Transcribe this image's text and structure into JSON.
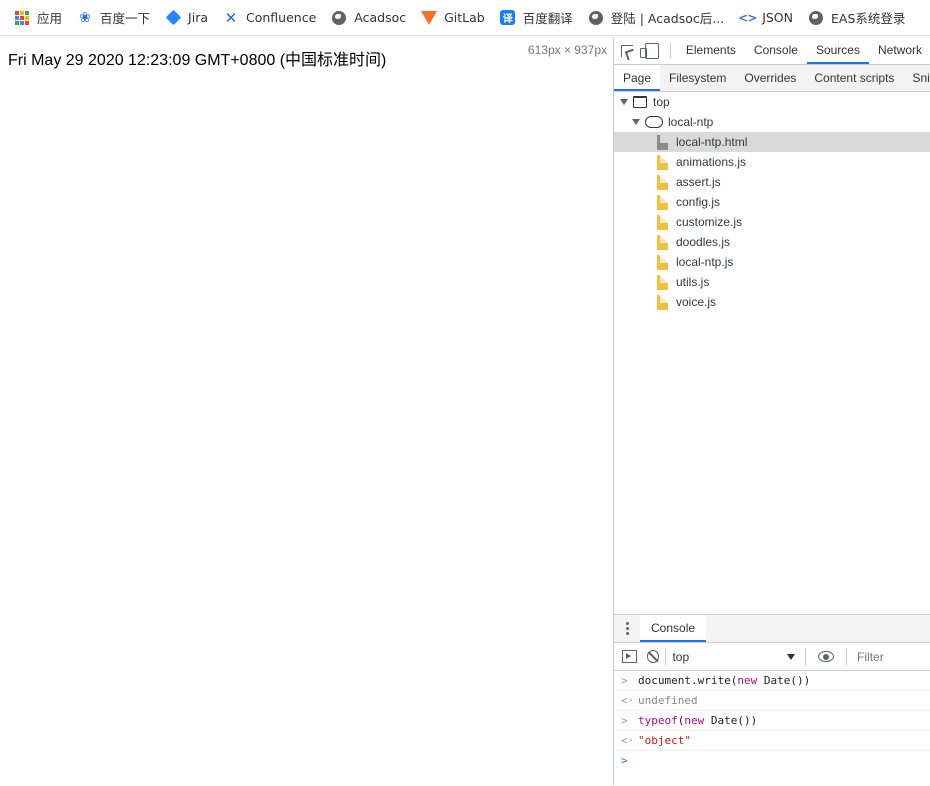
{
  "bookmarks": [
    {
      "icon": "apps-grid-icon",
      "label": "应用"
    },
    {
      "icon": "baidu-paw-icon",
      "label": "百度一下"
    },
    {
      "icon": "jira-icon",
      "label": "Jira"
    },
    {
      "icon": "confluence-icon",
      "label": "Confluence"
    },
    {
      "icon": "globe-icon",
      "label": "Acadsoc"
    },
    {
      "icon": "gitlab-icon",
      "label": "GitLab"
    },
    {
      "icon": "baidu-fanyi-icon",
      "label": "百度翻译"
    },
    {
      "icon": "globe-icon",
      "label": "登陆 | Acadsoc后..."
    },
    {
      "icon": "json-icon",
      "label": "JSON"
    },
    {
      "icon": "globe-icon",
      "label": "EAS系统登录"
    }
  ],
  "page": {
    "date_text": "Fri May 29 2020 12:23:09 GMT+0800 (中国标准时间)",
    "dimensions": "613px × 937px"
  },
  "devtools": {
    "tabs": [
      "Elements",
      "Console",
      "Sources",
      "Network"
    ],
    "active_tab": "Sources",
    "nav_tabs": [
      "Page",
      "Filesystem",
      "Overrides",
      "Content scripts",
      "Snippets"
    ],
    "active_nav_tab": "Page",
    "tree": {
      "frame": "top",
      "origin": "local-ntp",
      "files": [
        {
          "name": "local-ntp.html",
          "type": "html",
          "selected": true
        },
        {
          "name": "animations.js",
          "type": "js"
        },
        {
          "name": "assert.js",
          "type": "js"
        },
        {
          "name": "config.js",
          "type": "js"
        },
        {
          "name": "customize.js",
          "type": "js"
        },
        {
          "name": "doodles.js",
          "type": "js"
        },
        {
          "name": "local-ntp.js",
          "type": "js"
        },
        {
          "name": "utils.js",
          "type": "js"
        },
        {
          "name": "voice.js",
          "type": "js"
        }
      ]
    },
    "drawer": {
      "tab": "Console",
      "context": "top",
      "filter_placeholder": "Filter",
      "lines": {
        "l1_a": "document.write(",
        "l1_new": "new",
        "l1_b": " Date())",
        "l2": "undefined",
        "l3_typeof": "typeof",
        "l3_a": "(",
        "l3_new": "new",
        "l3_b": " Date())",
        "l4": "\"object\""
      },
      "prefixes": {
        "input": ">",
        "output": "<·",
        "prompt": ">"
      }
    }
  },
  "colors": {
    "accent": "#1a73e8",
    "folder_js": "#f0c040",
    "selected_row": "#dadada"
  }
}
